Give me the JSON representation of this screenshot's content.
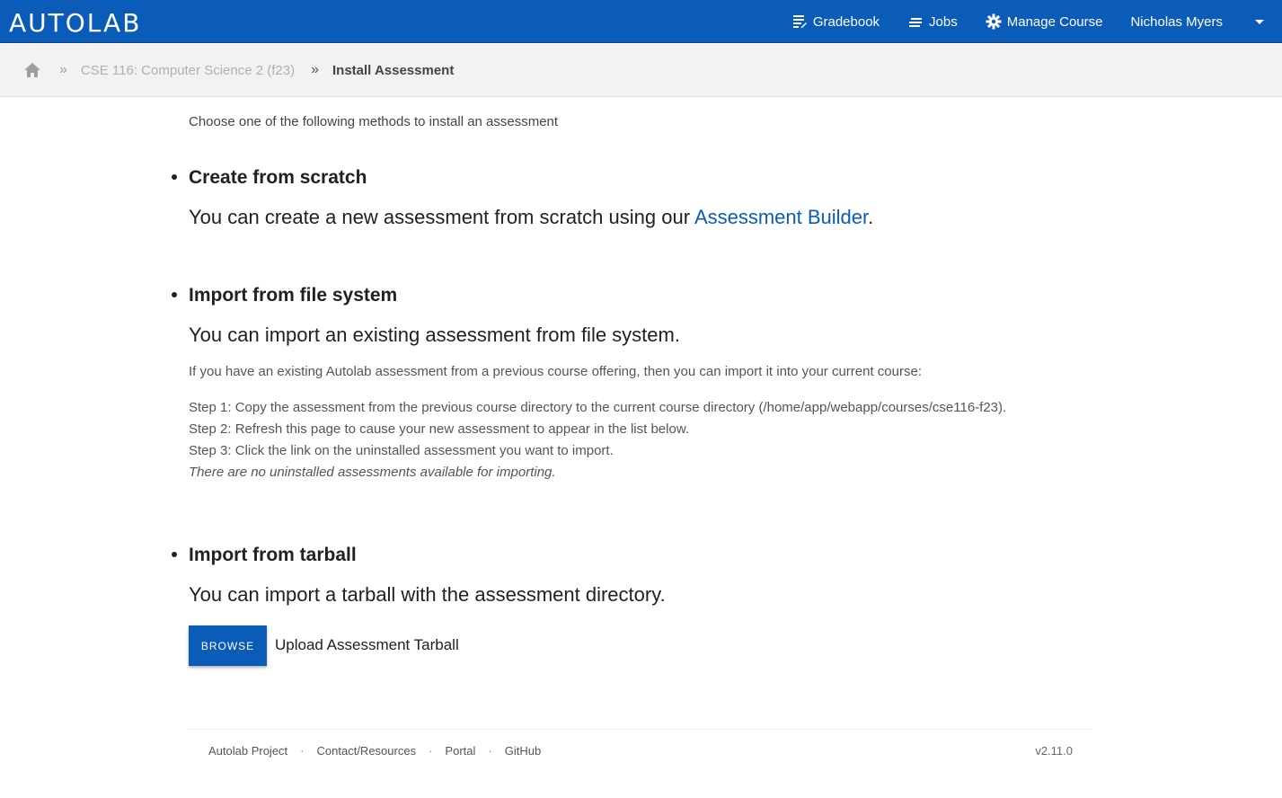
{
  "header": {
    "logo_text": "AUTOLAB",
    "nav": [
      {
        "label": "Gradebook",
        "icon": "gradebook-icon"
      },
      {
        "label": "Jobs",
        "icon": "jobs-icon"
      },
      {
        "label": "Manage Course",
        "icon": "gear-icon"
      }
    ],
    "user_name": "Nicholas Myers"
  },
  "breadcrumb": {
    "course": "CSE 116: Computer Science 2 (f23)",
    "current": "Install Assessment"
  },
  "main": {
    "intro": "Choose one of the following methods to install an assessment",
    "sections": [
      {
        "title": "Create from scratch",
        "subtitle_prefix": "You can create a new assessment from scratch using our ",
        "subtitle_link": "Assessment Builder",
        "subtitle_suffix": "."
      },
      {
        "title": "Import from file system",
        "subtitle": "You can import an existing assessment from file system.",
        "description": "If you have an existing Autolab assessment from a previous course offering, then you can import it into your current course:",
        "steps": [
          "Step 1: Copy the assessment from the previous course directory to the current course directory (/home/app/webapp/courses/cse116-f23).",
          "Step 2: Refresh this page to cause your new assessment to appear in the list below.",
          "Step 3: Click the link on the uninstalled assessment you want to import."
        ],
        "empty_note": "There are no uninstalled assessments available for importing."
      },
      {
        "title": "Import from tarball",
        "subtitle": "You can import a tarball with the assessment directory.",
        "browse_label": "BROWSE",
        "upload_label": "Upload Assessment Tarball"
      }
    ]
  },
  "footer": {
    "links": [
      "Autolab Project",
      "Contact/Resources",
      "Portal",
      "GitHub"
    ],
    "version": "v2.11.0"
  },
  "colors": {
    "brand": "#0b5cb8",
    "breadcrumb_bg": "#f3f2f1"
  }
}
